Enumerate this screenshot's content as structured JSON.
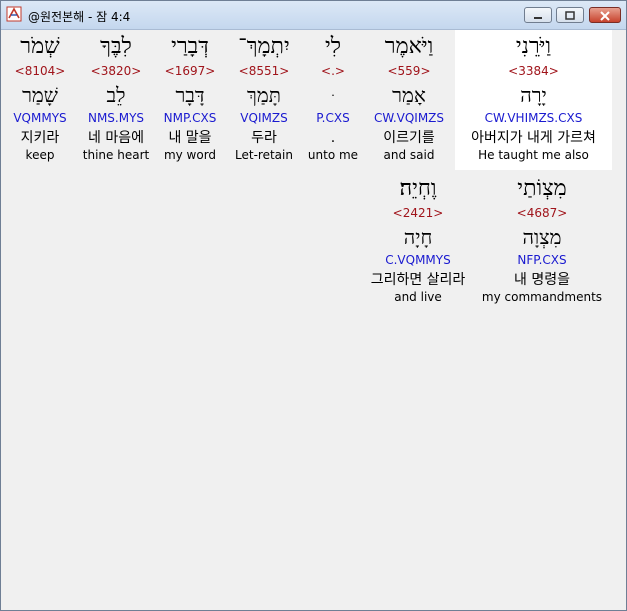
{
  "window": {
    "title": "@원전본해 - 잠 4:4",
    "icons": {
      "app": "app-logo-icon",
      "minimize": "minimize-icon",
      "maximize": "maximize-icon",
      "close": "close-icon"
    }
  },
  "words": [
    {
      "heb": "וַיֹּרֵנִי",
      "strong": "<3384>",
      "root": "יָרָה",
      "parse": "CW.VHIMZS.CXS",
      "kor": "아버지가 내게 가르쳐",
      "eng": "He taught me also",
      "selected": true
    },
    {
      "heb": "וַיֹּאמֶר",
      "strong": "<559>",
      "root": "אָמַר",
      "parse": "CW.VQIMZS",
      "kor": "이르기를",
      "eng": "and said"
    },
    {
      "heb": "לִי",
      "strong": "<.>",
      "root": "ּ",
      "parse": "P.CXS",
      "kor": ".",
      "eng": "unto me"
    },
    {
      "heb": "יִתְמָךְ־",
      "strong": "<8551>",
      "root": "תָּמַךְ",
      "parse": "VQIMZS",
      "kor": "두라",
      "eng": "Let-retain"
    },
    {
      "heb": "דְּבָרַי",
      "strong": "<1697>",
      "root": "דָּבָר",
      "parse": "NMP.CXS",
      "kor": "내 말을",
      "eng": "my word"
    },
    {
      "heb": "לִבֶּךָ",
      "strong": "<3820>",
      "root": "לֵב",
      "parse": "NMS.MYS",
      "kor": "네 마음에",
      "eng": "thine heart"
    },
    {
      "heb": "שְׁמֹר",
      "strong": "<8104>",
      "root": "שָׁמַר",
      "parse": "VQMMYS",
      "kor": "지키라",
      "eng": "keep"
    },
    {
      "heb": "מִצְוֹתַי",
      "strong": "<4687>",
      "root": "מִצְוָה",
      "parse": "NFP.CXS",
      "kor": "내 명령을",
      "eng": "my commandments"
    },
    {
      "heb": "וֶחְיֵה׃",
      "strong": "<2421>",
      "root": "חָיָה",
      "parse": "C.VQMMYS",
      "kor": "그리하면 살리라",
      "eng": "and live"
    }
  ]
}
